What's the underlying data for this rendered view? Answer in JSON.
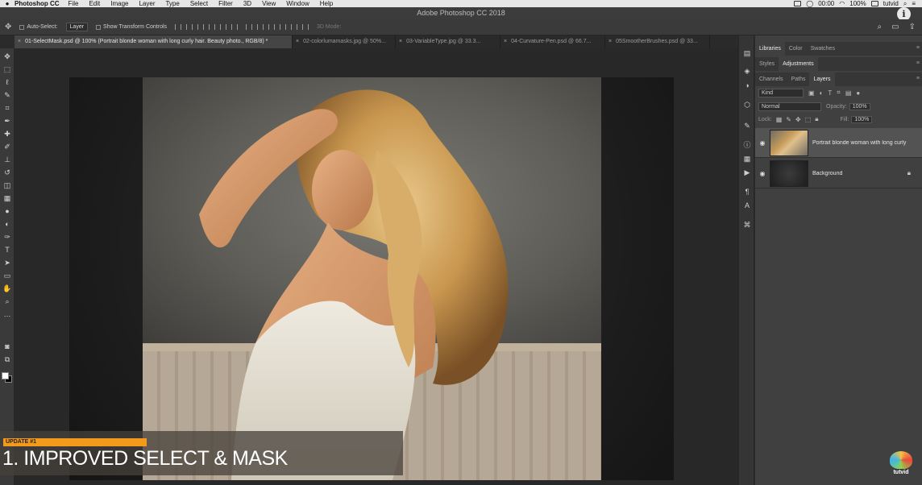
{
  "menubar": {
    "app": "Photoshop CC",
    "items": [
      "File",
      "Edit",
      "Image",
      "Layer",
      "Type",
      "Select",
      "Filter",
      "3D",
      "View",
      "Window",
      "Help"
    ],
    "clock": "00:00",
    "battery": "100%",
    "user": "tutvid"
  },
  "window": {
    "title": "Adobe Photoshop CC 2018"
  },
  "options": {
    "auto_select": "Auto-Select:",
    "layer_select": "Layer",
    "transform_controls": "Show Transform Controls",
    "mode_3d": "3D Mode:"
  },
  "tabs": [
    {
      "label": "01-SelectMask.psd @ 100% (Portrait  blonde woman with long curly hair. Beauty photo., RGB/8) *"
    },
    {
      "label": "02-colorlumamasks.jpg @ 50%..."
    },
    {
      "label": "03-VariableType.jpg @ 33.3..."
    },
    {
      "label": "04-Curvature-Pen.psd @ 66.7..."
    },
    {
      "label": "05SmootherBrushes.psd @ 33..."
    }
  ],
  "overlay": {
    "tag": "UPDATE #1",
    "headline": "1. IMPROVED SELECT & MASK"
  },
  "panels": {
    "row1": [
      "Libraries",
      "Color",
      "Swatches"
    ],
    "row2": [
      "Styles",
      "Adjustments"
    ],
    "row3": [
      "Channels",
      "Paths",
      "Layers"
    ],
    "kind": "Kind",
    "blend_mode": "Normal",
    "opacity_label": "Opacity:",
    "opacity_value": "100%",
    "lock_label": "Lock:",
    "fill_label": "Fill:",
    "fill_value": "100%"
  },
  "layers": [
    {
      "name": "Portrait  blonde woman with long curly ...",
      "visible": true,
      "selected": true
    },
    {
      "name": "Background",
      "visible": true,
      "selected": false,
      "locked": true
    }
  ],
  "logo": {
    "text": "tutvid"
  },
  "colors": {
    "accent": "#f39a1c",
    "panel": "#404040",
    "canvas": "#282828"
  }
}
